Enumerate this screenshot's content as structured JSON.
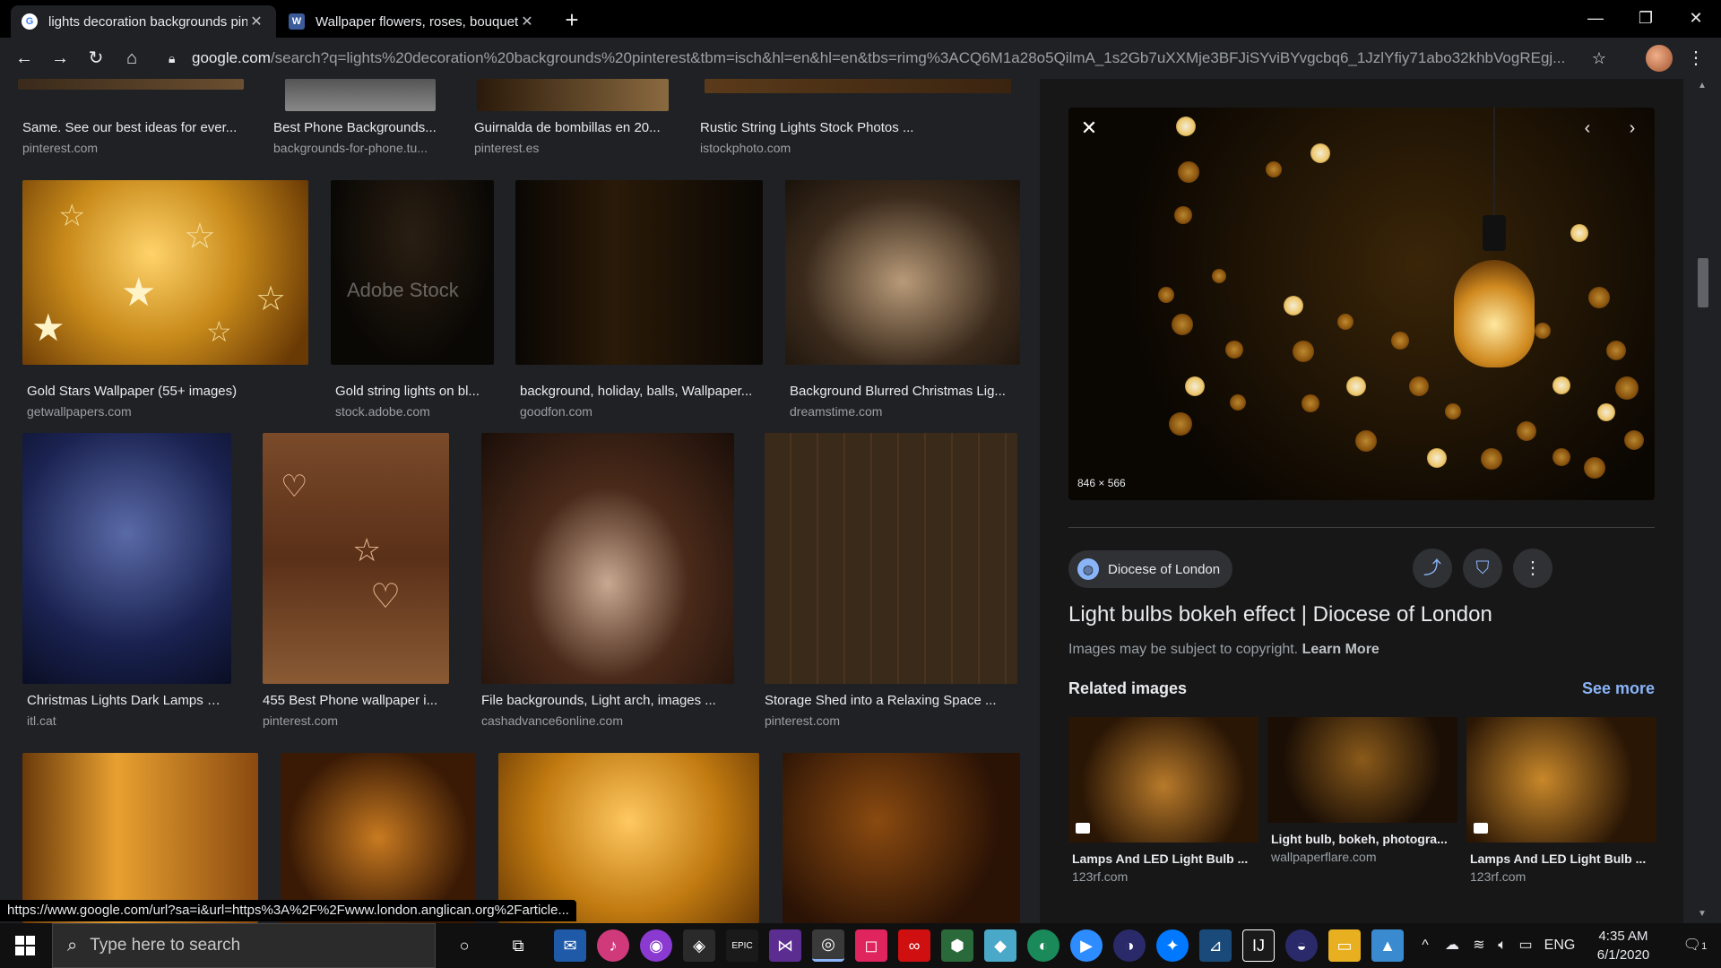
{
  "tabs": [
    {
      "title": "lights decoration backgrounds pinterest",
      "close": "✕",
      "active": true
    },
    {
      "title": "Wallpaper flowers, roses, bouquet",
      "close": "✕",
      "active": false
    }
  ],
  "window": {
    "minimize": "—",
    "restore": "❐",
    "close": "✕",
    "new_tab": "+"
  },
  "toolbar": {
    "back": "←",
    "forward": "→",
    "reload": "↻",
    "home": "⌂",
    "url_host": "google.com",
    "url_rest": "/search?q=lights%20decoration%20backgrounds%20pinterest&tbm=isch&hl=en&hl=en&tbs=rimg%3ACQ6M1a28o5QilmA_1s2Gb7uXXMje3BFJiSYviBYvgcbq6_1JzlYfiy71abo32khbVogREgj...",
    "star": "☆",
    "menu": "⋮"
  },
  "results": {
    "row0": [
      {
        "caption": "Same. See our best ideas for ever...",
        "source": "pinterest.com"
      },
      {
        "caption": "Best Phone Backgrounds...",
        "source": "backgrounds-for-phone.tu..."
      },
      {
        "caption": "Guirnalda de bombillas en 20...",
        "source": "pinterest.es"
      },
      {
        "caption": "Rustic String Lights Stock Photos ...",
        "source": "istockphoto.com"
      }
    ],
    "row1": [
      {
        "caption": "Gold Stars Wallpaper (55+ images)",
        "source": "getwallpapers.com"
      },
      {
        "caption": "Gold string lights on bl...",
        "source": "stock.adobe.com",
        "watermark": "Adobe Stock"
      },
      {
        "caption": "background, holiday, balls, Wallpaper...",
        "source": "goodfon.com"
      },
      {
        "caption": "Background Blurred Christmas Lig...",
        "source": "dreamstime.com"
      }
    ],
    "row2": [
      {
        "caption": "Christmas Lights Dark Lamps S...",
        "source": "itl.cat"
      },
      {
        "caption": "455 Best Phone wallpaper i...",
        "source": "pinterest.com"
      },
      {
        "caption": "File backgrounds, Light arch, images ...",
        "source": "cashadvance6online.com"
      },
      {
        "caption": "Storage Shed into a Relaxing Space ...",
        "source": "pinterest.com"
      }
    ]
  },
  "preview": {
    "close": "✕",
    "prev": "‹",
    "next": "›",
    "dimensions": "846 × 566",
    "site": "Diocese of London",
    "title": "Light bulbs bokeh effect | Diocese of London",
    "copyright": "Images may be subject to copyright.",
    "learn_more": "Learn More",
    "related_heading": "Related images",
    "see_more": "See more",
    "related": [
      {
        "caption": "Lamps And LED Light Bulb ...",
        "source": "123rf.com"
      },
      {
        "caption": "Light bulb, bokeh, photogra...",
        "source": "wallpaperflare.com"
      },
      {
        "caption": "Lamps And LED Light Bulb ...",
        "source": "123rf.com"
      }
    ]
  },
  "status_url": "https://www.google.com/url?sa=i&url=https%3A%2F%2Fwww.london.anglican.org%2Farticle...",
  "taskbar": {
    "search_placeholder": "Type here to search",
    "lang": "ENG",
    "time": "4:35 AM",
    "date": "6/1/2020",
    "notifications": "1"
  },
  "colors": {
    "accent_link": "#8ab4f8",
    "background": "#202124",
    "panel": "#171717"
  }
}
